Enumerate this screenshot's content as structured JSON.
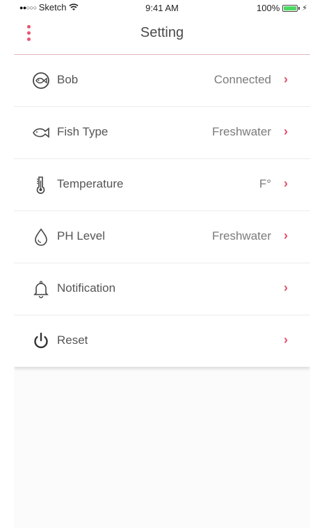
{
  "status_bar": {
    "signal": "●●○○○",
    "carrier": "Sketch",
    "time": "9:41 AM",
    "battery_text": "100%",
    "battery_level": 1.0
  },
  "nav": {
    "title": "Setting",
    "menu_icon": "more-vertical-icon"
  },
  "colors": {
    "accent": "#e34b69",
    "text": "#555555",
    "value_text": "#7a7a7a",
    "battery": "#4cd964"
  },
  "settings": [
    {
      "icon": "fish-circle-icon",
      "label": "Bob",
      "value": "Connected"
    },
    {
      "icon": "fish-icon",
      "label": "Fish Type",
      "value": "Freshwater"
    },
    {
      "icon": "thermometer-icon",
      "label": "Temperature",
      "value": "F°"
    },
    {
      "icon": "drop-icon",
      "label": "PH Level",
      "value": "Freshwater"
    },
    {
      "icon": "bell-icon",
      "label": "Notification",
      "value": ""
    },
    {
      "icon": "power-icon",
      "label": "Reset",
      "value": ""
    }
  ],
  "chevron": "›"
}
